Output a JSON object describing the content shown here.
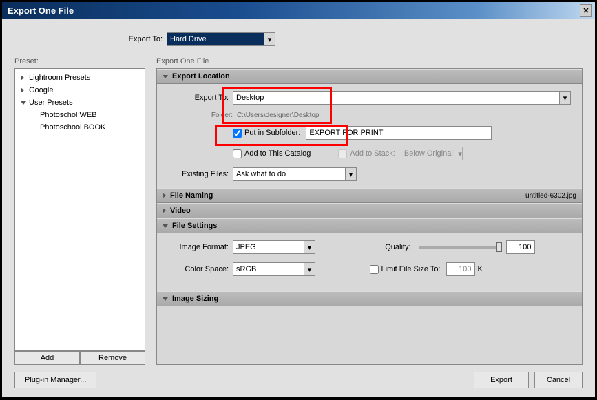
{
  "window": {
    "title": "Export One File"
  },
  "exportTo": {
    "label": "Export To:",
    "value": "Hard Drive"
  },
  "presets": {
    "label": "Preset:",
    "items": [
      {
        "label": "Lightroom Presets",
        "expanded": false
      },
      {
        "label": "Google",
        "expanded": false
      },
      {
        "label": "User Presets",
        "expanded": true,
        "children": [
          {
            "label": "Photoschol WEB"
          },
          {
            "label": "Photoschool BOOK"
          }
        ]
      }
    ],
    "addBtn": "Add",
    "removeBtn": "Remove"
  },
  "rightLabel": "Export One File",
  "sections": {
    "exportLocation": {
      "title": "Export Location",
      "exportToLabel": "Export To:",
      "exportToValue": "Desktop",
      "folderLabel": "Folder:",
      "folderValue": "C:\\Users\\designer\\Desktop",
      "subfolderLabel": "Put in Subfolder:",
      "subfolderValue": "EXPORT FOR PRINT",
      "addCatalogLabel": "Add to This Catalog",
      "addStackLabel": "Add to Stack:",
      "stackValue": "Below Original",
      "existingLabel": "Existing Files:",
      "existingValue": "Ask what to do"
    },
    "fileNaming": {
      "title": "File Naming",
      "hint": "untitled-6302.jpg"
    },
    "video": {
      "title": "Video"
    },
    "fileSettings": {
      "title": "File Settings",
      "formatLabel": "Image Format:",
      "formatValue": "JPEG",
      "qualityLabel": "Quality:",
      "qualityValue": "100",
      "colorLabel": "Color Space:",
      "colorValue": "sRGB",
      "limitLabel": "Limit File Size To:",
      "limitValue": "100",
      "limitUnit": "K"
    },
    "imageSizing": {
      "title": "Image Sizing"
    }
  },
  "bottom": {
    "pluginBtn": "Plug-in Manager...",
    "exportBtn": "Export",
    "cancelBtn": "Cancel"
  }
}
